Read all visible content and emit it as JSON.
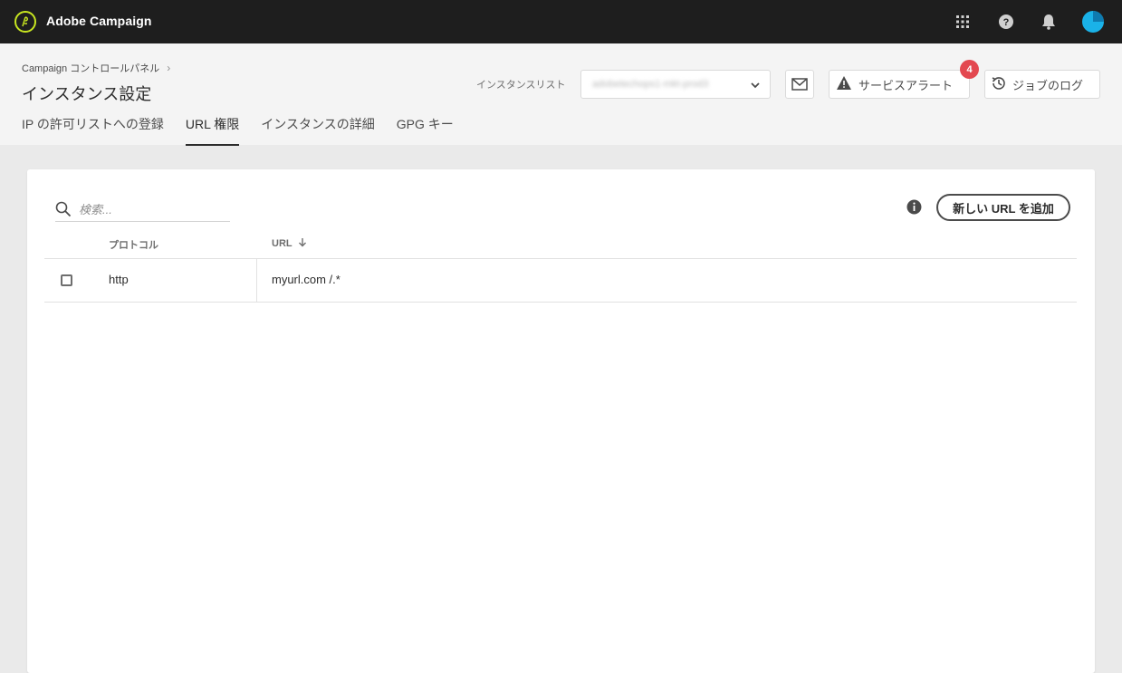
{
  "app": {
    "title": "Adobe Campaign"
  },
  "topbar": {
    "icons": [
      "apps-grid-icon",
      "help-icon",
      "bell-icon",
      "avatar"
    ]
  },
  "header": {
    "breadcrumb": "Campaign コントロールパネル",
    "title": "インスタンス設定",
    "tabs": [
      {
        "label": "IP の許可リストへの登録",
        "active": false
      },
      {
        "label": "URL 権限",
        "active": true
      },
      {
        "label": "インスタンスの詳細",
        "active": false
      },
      {
        "label": "GPG キー",
        "active": false
      }
    ],
    "instance_label": "インスタンスリスト",
    "instance_value": "adobetechops1-mkt-prod3",
    "alert_label": "サービスアラート",
    "alert_count": "4",
    "log_label": "ジョブのログ"
  },
  "content": {
    "search_placeholder": "検索...",
    "add_button": "新しい URL を追加",
    "columns": {
      "protocol": "プロトコル",
      "url": "URL"
    },
    "rows": [
      {
        "protocol": "http",
        "url": "myurl.com /.*"
      }
    ]
  },
  "colors": {
    "topbar": "#1e1e1e",
    "logo_accent": "#c8e620",
    "badge": "#e34850",
    "avatar": "#1ab2e8"
  }
}
